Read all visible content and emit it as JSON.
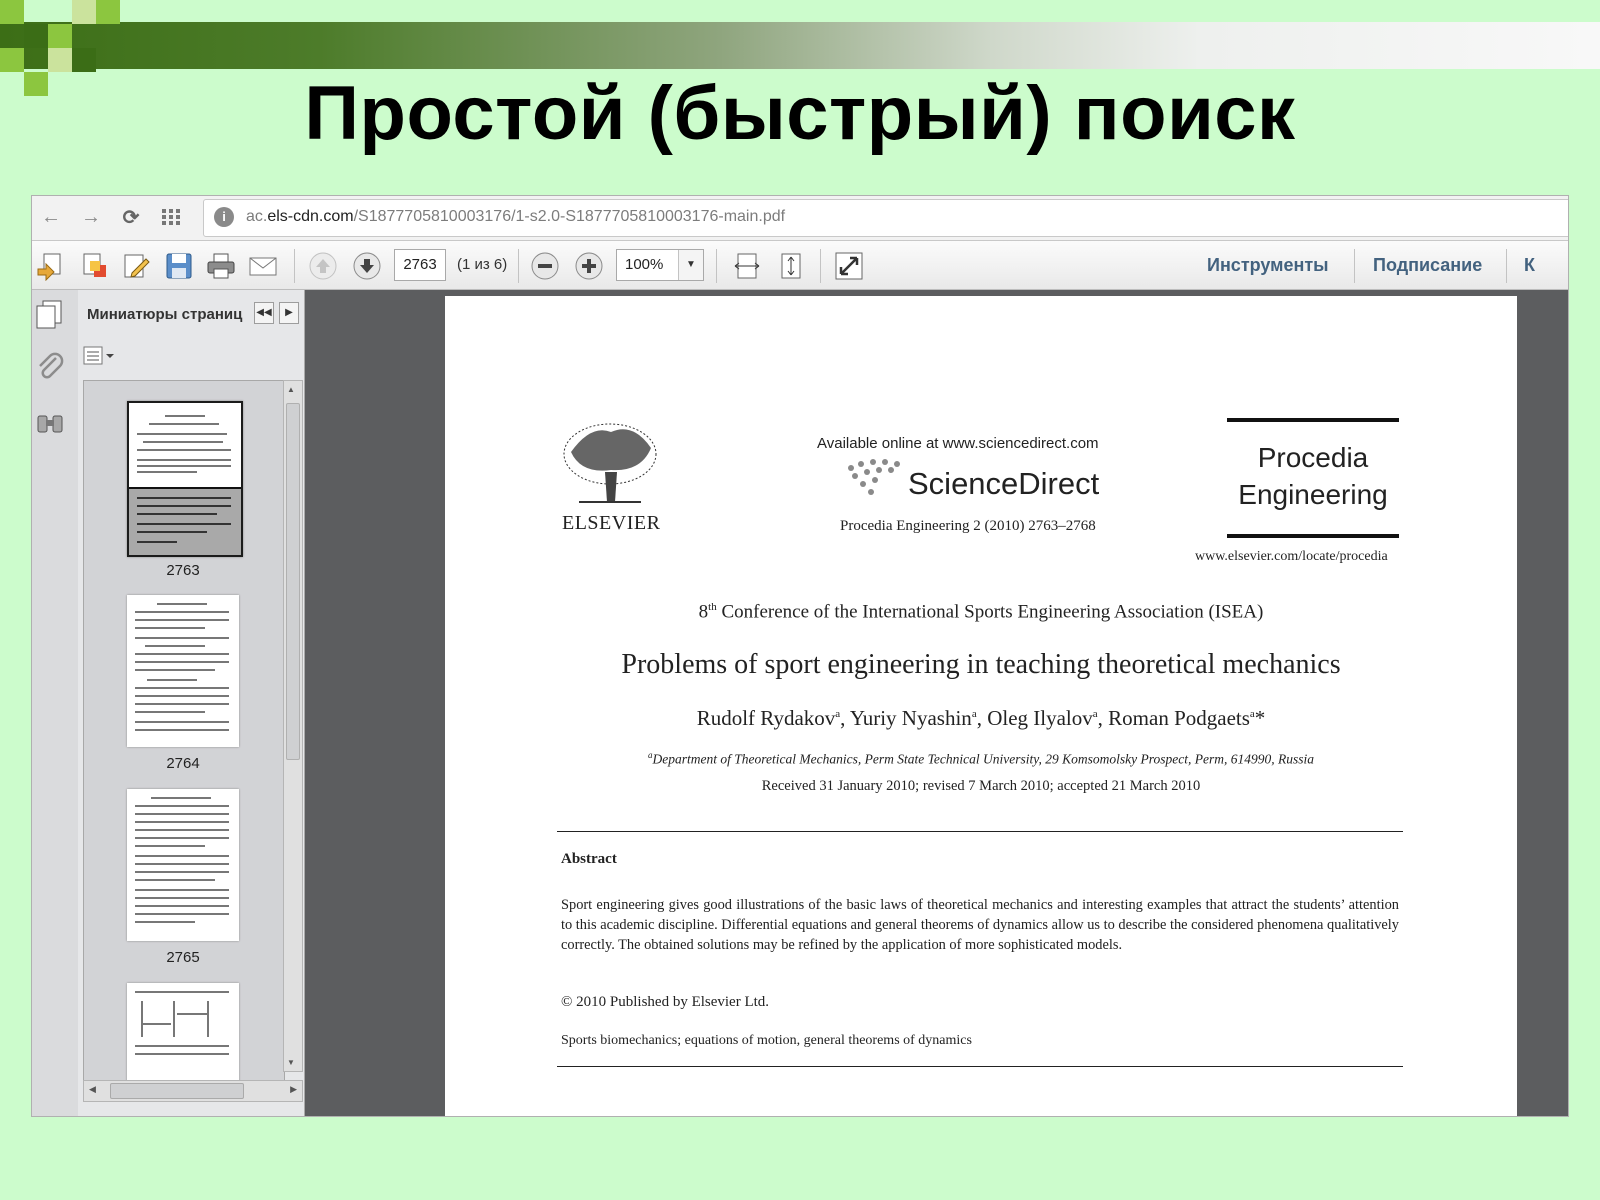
{
  "slide": {
    "title": "Простой (быстрый) поиск"
  },
  "browser": {
    "url_prefix": "ac.",
    "url_domain": "els-cdn.com",
    "url_path": "/S1877705810003176/1-s2.0-S1877705810003176-main.pdf"
  },
  "toolbar": {
    "page_number": "2763",
    "page_of": "(1 из 6)",
    "zoom": "100%",
    "tools_label": "Инструменты",
    "sign_label": "Подписание",
    "more_label": "К"
  },
  "panel": {
    "title": "Миниатюры страниц",
    "thumbnails": [
      "2763",
      "2764",
      "2765"
    ]
  },
  "document": {
    "publisher": "ELSEVIER",
    "available_online": "Available online at www.sciencedirect.com",
    "sciencedirect": "ScienceDirect",
    "citation": "Procedia Engineering 2 (2010) 2763–2768",
    "journal_line1": "Procedia",
    "journal_line2": "Engineering",
    "journal_url": "www.elsevier.com/locate/procedia",
    "conf_number": "8",
    "conf_sup": "th",
    "conf_rest": " Conference of the International Sports Engineering Association (ISEA)",
    "title": "Problems of sport engineering in teaching theoretical mechanics",
    "authors": [
      {
        "name": "Rudolf Rydakov",
        "sup": "a",
        "sep": ", "
      },
      {
        "name": "Yuriy Nyashin",
        "sup": "a",
        "sep": ", "
      },
      {
        "name": "Oleg Ilyalov",
        "sup": "a",
        "sep": ", "
      },
      {
        "name": "Roman Podgaets",
        "sup": "a",
        "sep": "*"
      }
    ],
    "affiliation_sup": "a",
    "affiliation": "Department of Theoretical Mechanics, Perm State Technical University, 29 Komsomolsky Prospect, Perm, 614990, Russia",
    "received": "Received 31 January 2010; revised 7 March 2010; accepted 21 March 2010",
    "abstract_heading": "Abstract",
    "abstract": "Sport engineering gives good illustrations of the basic laws of theoretical mechanics and interesting examples that attract the students’ attention to this academic discipline. Differential equations and general theorems of dynamics allow us to describe the considered phenomena qualitatively correctly. The obtained solutions may be refined by the application of more sophisticated models.",
    "copyright": "© 2010 Published by Elsevier Ltd.",
    "keywords": "Sports biomechanics; equations of motion, general theorems of dynamics"
  },
  "colors": {
    "slide_bg": "#ccfccc",
    "band_dark": "#3c6e16",
    "square_green": "#8cc63f",
    "link_blue": "#43627f"
  },
  "icons": [
    "back-arrow-icon",
    "forward-arrow-icon",
    "reload-icon",
    "apps-grid-icon",
    "globe-icon",
    "create-pdf-icon",
    "export-icon",
    "edit-icon",
    "save-icon",
    "print-icon",
    "email-icon",
    "page-up-icon",
    "page-down-icon",
    "zoom-out-icon",
    "zoom-in-icon",
    "fit-width-icon",
    "fit-page-icon",
    "fullscreen-icon",
    "pages-icon",
    "paperclip-icon",
    "binoculars-icon"
  ]
}
